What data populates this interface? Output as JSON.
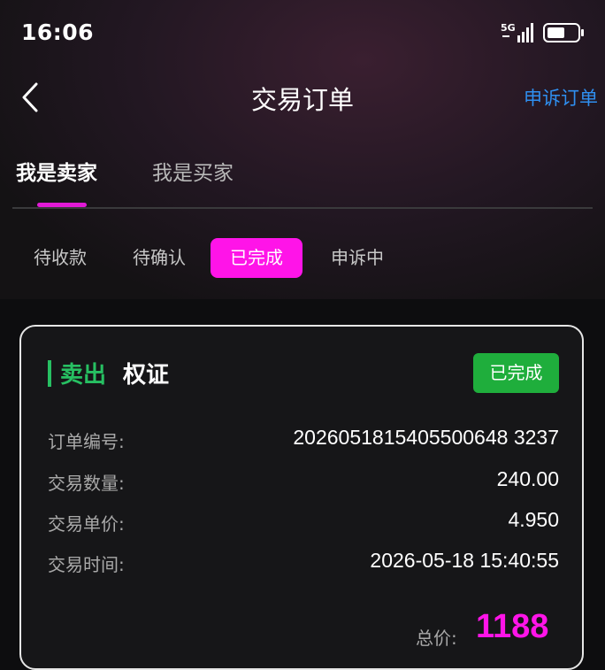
{
  "status_bar": {
    "time": "16:06",
    "network": "5G"
  },
  "header": {
    "title": "交易订单",
    "appeal_link": "申诉订单"
  },
  "role_tabs": [
    {
      "label": "我是卖家",
      "active": true
    },
    {
      "label": "我是买家",
      "active": false
    }
  ],
  "status_filters": [
    {
      "label": "待收款",
      "active": false
    },
    {
      "label": "待确认",
      "active": false
    },
    {
      "label": "已完成",
      "active": true
    },
    {
      "label": "申诉中",
      "active": false
    }
  ],
  "order": {
    "side": "卖出",
    "asset": "权证",
    "status": "已完成",
    "rows": [
      {
        "label": "订单编号:",
        "value": "2026051815405500648 3237"
      },
      {
        "label": "交易数量:",
        "value": "240.00"
      },
      {
        "label": "交易单价:",
        "value": "4.950"
      },
      {
        "label": "交易时间:",
        "value": "2026-05-18 15:40:55"
      }
    ],
    "total_label": "总价:",
    "total_value": "1188"
  },
  "colors": {
    "accent": "#ff14e8",
    "sell_green": "#27c062",
    "done_badge": "#1fae3c",
    "link_blue": "#2f8ff0"
  }
}
